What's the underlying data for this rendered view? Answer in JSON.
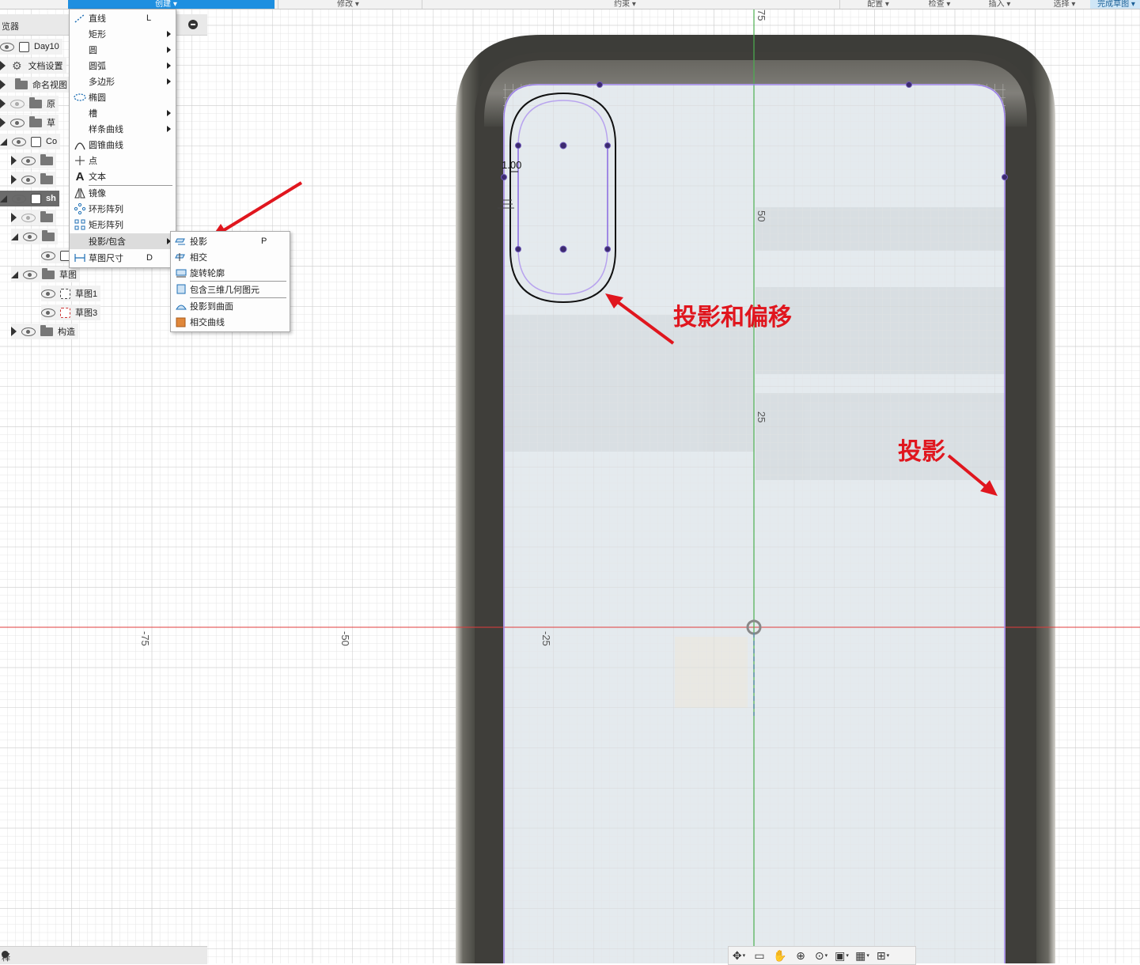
{
  "toolbar": {
    "create": "创建 ▾",
    "modify": "修改 ▾",
    "constrain": "约束 ▾",
    "configure": "配置 ▾",
    "inspect": "检查 ▾",
    "insert": "插入 ▾",
    "select": "选择 ▾",
    "finish": "完成草图 ▾"
  },
  "browser": {
    "title": "览器",
    "footer": "释",
    "nodes": {
      "root": "Day10",
      "doc_settings": "文档设置",
      "named_views": "命名视图",
      "origin": "原",
      "sketches_top": "草",
      "component": "Co",
      "body": "sh",
      "sketches": "草图",
      "sketch1": "草图1",
      "sketch3": "草图3",
      "construction": "构造"
    }
  },
  "create_menu": {
    "items": [
      {
        "label": "直线",
        "key": "L"
      },
      {
        "label": "矩形"
      },
      {
        "label": "圆"
      },
      {
        "label": "圆弧"
      },
      {
        "label": "多边形"
      },
      {
        "label": "椭圆"
      },
      {
        "label": "槽"
      },
      {
        "label": "样条曲线"
      },
      {
        "label": "圆锥曲线"
      },
      {
        "label": "点"
      },
      {
        "label": "文本"
      },
      {
        "label": "镜像"
      },
      {
        "label": "环形阵列"
      },
      {
        "label": "矩形阵列"
      },
      {
        "label": "投影/包含"
      },
      {
        "label": "草图尺寸",
        "key": "D"
      }
    ]
  },
  "project_submenu": {
    "items": [
      {
        "label": "投影",
        "key": "P"
      },
      {
        "label": "相交"
      },
      {
        "label": "旋转轮廓"
      },
      {
        "label": "包含三维几何图元"
      },
      {
        "label": "投影到曲面"
      },
      {
        "label": "相交曲线"
      }
    ]
  },
  "canvas": {
    "axis_labels": {
      "y75": "75",
      "y50": "50",
      "y25": "25",
      "xm75": "-75",
      "xm50": "-50",
      "xm25": "-25"
    },
    "dimension": "1.00",
    "annotations": {
      "offset": "投影和偏移",
      "project": "投影"
    },
    "colors": {
      "x_axis": "#e03c3c",
      "y_axis": "#4caf50",
      "sketch": "#9b7fe6",
      "annotation": "#e0161e"
    }
  },
  "navbar": {
    "icons": [
      "orbit-icon",
      "look-at-icon",
      "pan-icon",
      "zoom-icon",
      "fit-icon",
      "display-icon",
      "grid-icon",
      "viewports-icon"
    ]
  }
}
